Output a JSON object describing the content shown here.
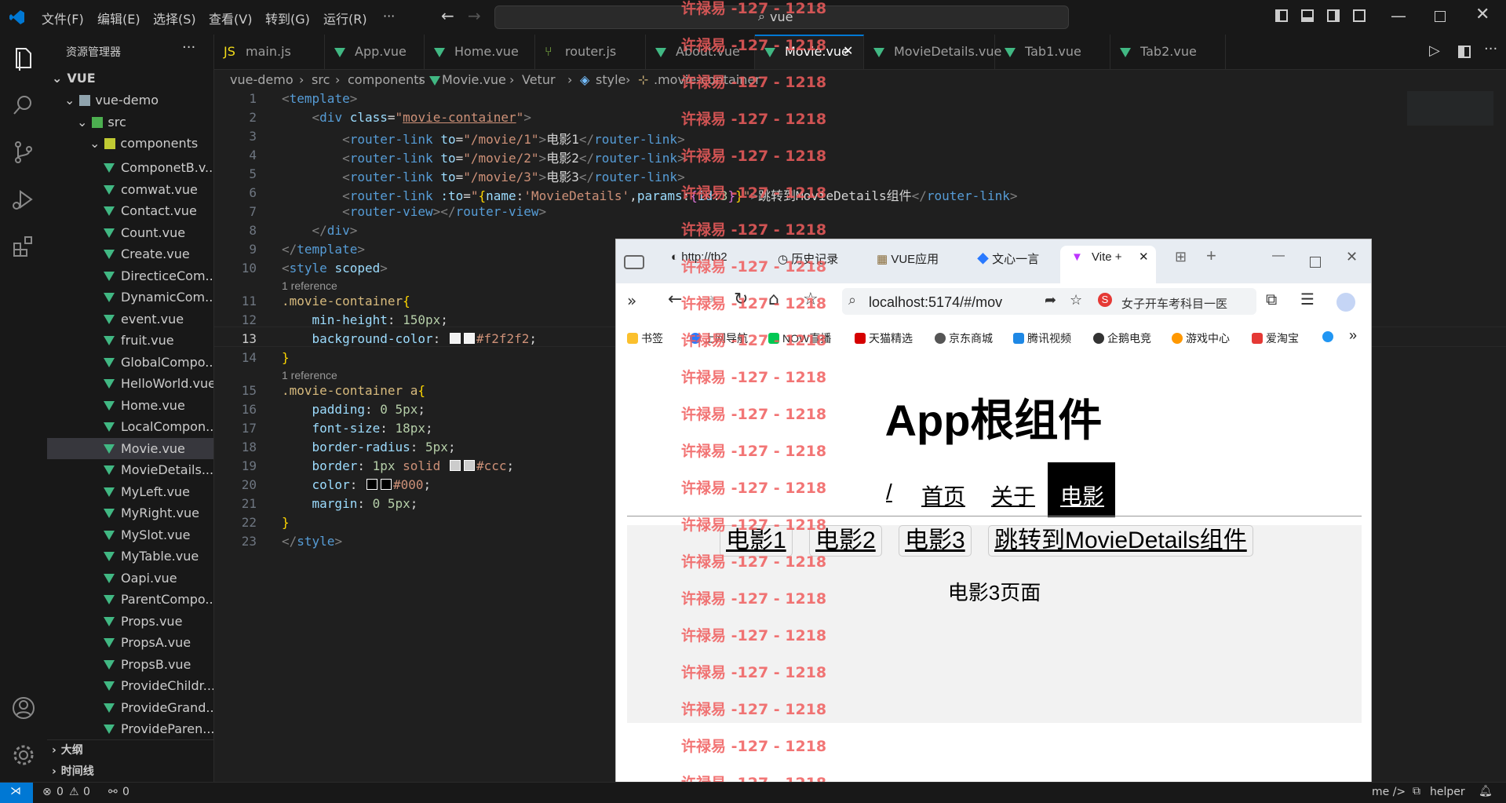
{
  "menu": [
    "文件(F)",
    "编辑(E)",
    "选择(S)",
    "查看(V)",
    "转到(G)",
    "运行(R)",
    "···"
  ],
  "search_text": "vue",
  "sidebar": {
    "title": "资源管理器",
    "root": "VUE",
    "folders": [
      "vue-demo",
      "src",
      "components"
    ],
    "files": [
      "ComponetB.v...",
      "comwat.vue",
      "Contact.vue",
      "Count.vue",
      "Create.vue",
      "DirecticeCom...",
      "DynamicCom...",
      "event.vue",
      "fruit.vue",
      "GlobalCompo...",
      "HelloWorld.vue",
      "Home.vue",
      "LocalCompon...",
      "Movie.vue",
      "MovieDetails....",
      "MyLeft.vue",
      "MyRight.vue",
      "MySlot.vue",
      "MyTable.vue",
      "Oapi.vue",
      "ParentCompo...",
      "Props.vue",
      "PropsA.vue",
      "PropsB.vue",
      "ProvideChildr...",
      "ProvideGrand...",
      "ProvideParen..."
    ],
    "outline": "大纲",
    "timeline": "时间线"
  },
  "tabs": [
    "main.js",
    "App.vue",
    "Home.vue",
    "router.js",
    "About.vue",
    "Movie.vue",
    "MovieDetails.vue",
    "Tab1.vue",
    "Tab2.vue"
  ],
  "breadcrumb": [
    "vue-demo",
    "src",
    "components",
    "Movie.vue",
    "Vetur",
    "style",
    ".movie-container"
  ],
  "code": {
    "reference": "1 reference",
    "line_numbers": [
      "1",
      "2",
      "3",
      "4",
      "5",
      "6",
      "7",
      "8",
      "9",
      "10",
      "11",
      "12",
      "13",
      "14",
      "15",
      "16",
      "17",
      "18",
      "19",
      "20",
      "21",
      "22",
      "23"
    ],
    "colors": {
      "bg1": "#f2f2f2",
      "border": "#ccc",
      "text": "#000"
    }
  },
  "status": {
    "errors": "0",
    "warnings": "0",
    "ports": "0",
    "right1": "me />",
    "right2": "helper"
  },
  "browser": {
    "tabs": [
      "http://tb2",
      "历史记录",
      "VUE应用",
      "文心一言",
      "Vite +"
    ],
    "url": "localhost:5174/#/mov",
    "search_hint": "女子开车考科目一医",
    "bookmarks": [
      "书签",
      "上网导航",
      "NOW直播",
      "天猫精选",
      "京东商城",
      "腾讯视频",
      "企鹅电竞",
      "游戏中心",
      "爱淘宝"
    ],
    "page": {
      "heading": "App根组件",
      "nav": [
        "/",
        "首页",
        "关于",
        "电影"
      ],
      "movie_links": [
        "电影1",
        "电影2",
        "电影3",
        "跳转到MovieDetails组件"
      ],
      "movie_page_text": "电影3页面"
    }
  },
  "watermark": "许禄易 -127 - 1218"
}
